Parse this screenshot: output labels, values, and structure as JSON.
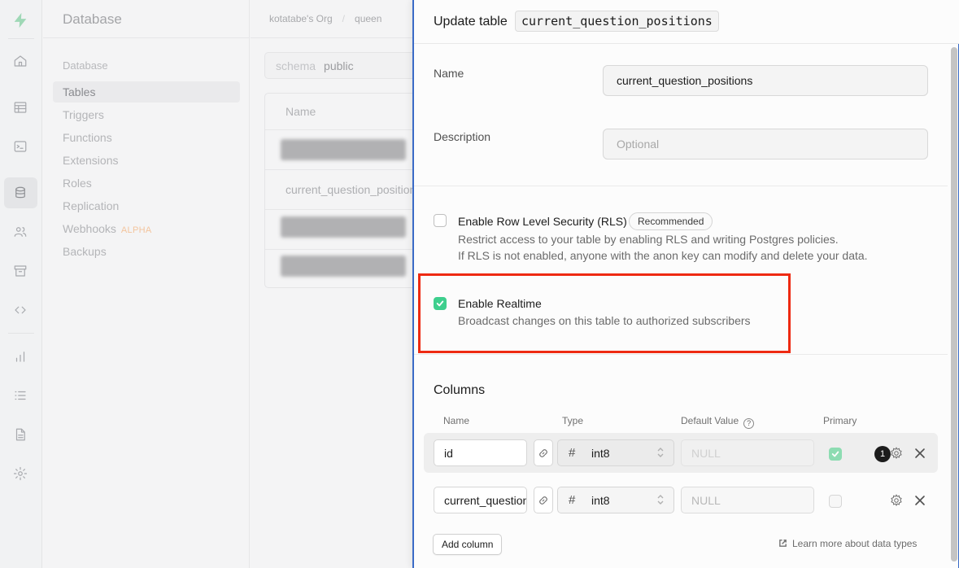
{
  "sidebar": {
    "title": "Database",
    "section": "Database",
    "items": [
      {
        "label": "Tables"
      },
      {
        "label": "Triggers"
      },
      {
        "label": "Functions"
      },
      {
        "label": "Extensions"
      },
      {
        "label": "Roles"
      },
      {
        "label": "Replication"
      },
      {
        "label": "Webhooks",
        "badge": "ALPHA"
      },
      {
        "label": "Backups"
      }
    ]
  },
  "breadcrumb": {
    "org": "kotatabe's Org",
    "project": "queen"
  },
  "schema": {
    "label": "schema",
    "value": "public"
  },
  "tables_list": {
    "header": "Name",
    "visible_row": "current_question_positions"
  },
  "panel": {
    "title": "Update table",
    "table_name_code": "current_question_positions",
    "name_label": "Name",
    "name_value": "current_question_positions",
    "description_label": "Description",
    "description_placeholder": "Optional",
    "rls": {
      "title": "Enable Row Level Security (RLS)",
      "badge": "Recommended",
      "desc1": "Restrict access to your table by enabling RLS and writing Postgres policies.",
      "desc2": "If RLS is not enabled, anyone with the anon key can modify and delete your data."
    },
    "realtime": {
      "title": "Enable Realtime",
      "desc": "Broadcast changes on this table to authorized subscribers"
    },
    "columns": {
      "title": "Columns",
      "headers": {
        "name": "Name",
        "type": "Type",
        "default": "Default Value",
        "primary": "Primary"
      },
      "rows": [
        {
          "name": "id",
          "type": "int8",
          "default_placeholder": "NULL",
          "count": "1"
        },
        {
          "name": "current_question",
          "type": "int8",
          "default_placeholder": "NULL"
        }
      ],
      "add_label": "Add column",
      "learn_label": "Learn more about data types"
    }
  },
  "colors": {
    "accent": "#3ecf8e",
    "highlight": "#ee2a12",
    "panel_border": "#3a6bc7"
  }
}
